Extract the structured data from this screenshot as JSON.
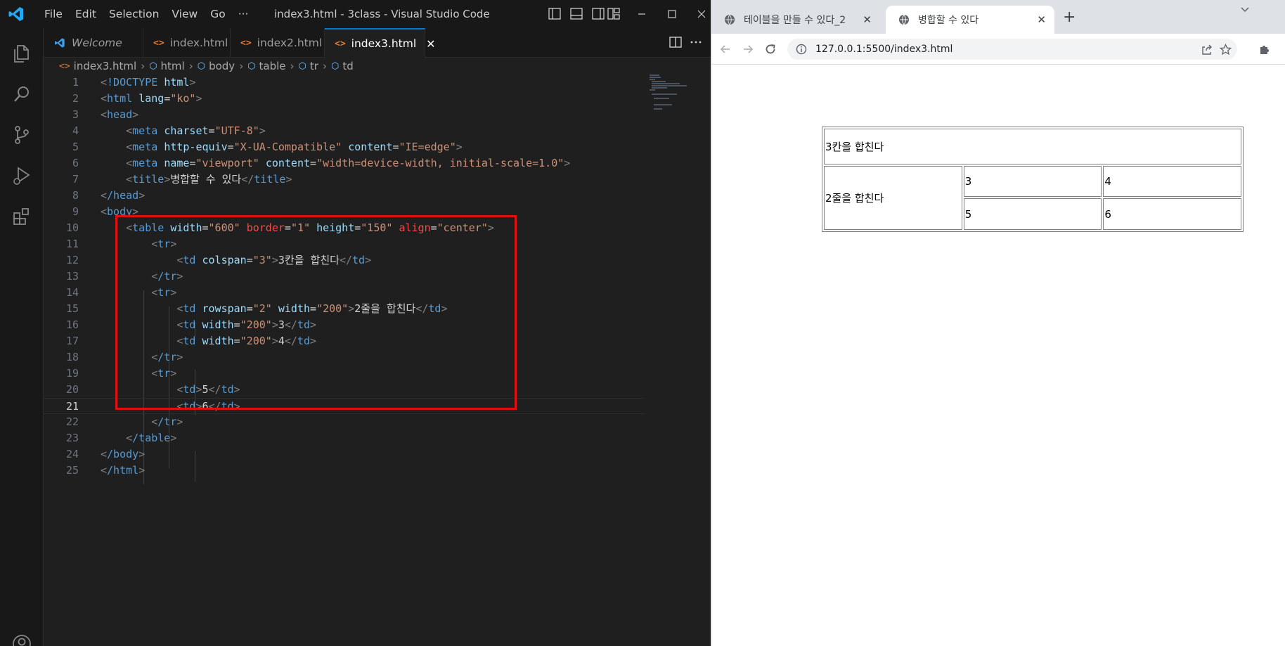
{
  "vscode": {
    "title": "index3.html - 3class - Visual Studio Code",
    "menu": [
      "File",
      "Edit",
      "Selection",
      "View",
      "Go",
      "···"
    ],
    "tabs": [
      {
        "label": "Welcome"
      },
      {
        "label": "index.html"
      },
      {
        "label": "index2.html"
      },
      {
        "label": "index3.html",
        "close": "✕"
      }
    ],
    "breadcrumb": [
      "index3.html",
      "html",
      "body",
      "table",
      "tr",
      "td"
    ],
    "line_numbers": [
      "1",
      "2",
      "3",
      "4",
      "5",
      "6",
      "7",
      "8",
      "9",
      "10",
      "11",
      "12",
      "13",
      "14",
      "15",
      "16",
      "17",
      "18",
      "19",
      "20",
      "21",
      "22",
      "23",
      "24",
      "25"
    ],
    "current_line": "21",
    "colors": {
      "accent": "#0078d4",
      "highlight_box": "#e01010",
      "tag": "#569cd6",
      "attr": "#9cdcfe",
      "value": "#ce9178"
    }
  },
  "code": {
    "l1": {
      "doctype": "!DOCTYPE",
      "html": "html"
    },
    "l2": {
      "tag": "html",
      "attr": "lang",
      "val": "\"ko\""
    },
    "l3": {
      "tag": "head"
    },
    "l4": {
      "tag": "meta",
      "attr": "charset",
      "val": "\"UTF-8\""
    },
    "l5": {
      "tag": "meta",
      "attr1": "http-equiv",
      "val1": "\"X-UA-Compatible\"",
      "attr2": "content",
      "val2": "\"IE=edge\""
    },
    "l6": {
      "tag": "meta",
      "attr1": "name",
      "val1": "\"viewport\"",
      "attr2": "content",
      "val2": "\"width=device-width, initial-scale=1.0\""
    },
    "l7": {
      "tag": "title",
      "text": "병합할 수 있다"
    },
    "l8": {
      "tag": "/head"
    },
    "l9": {
      "tag": "body"
    },
    "l10": {
      "tag": "table",
      "a1": "width",
      "v1": "\"600\"",
      "a2": "border",
      "v2": "\"1\"",
      "a3": "height",
      "v3": "\"150\"",
      "a4": "align",
      "v4": "\"center\""
    },
    "l11": {
      "tag": "tr"
    },
    "l12": {
      "tag": "td",
      "attr": "colspan",
      "val": "\"3\"",
      "text": "3칸을 합친다"
    },
    "l13": {
      "tag": "/tr"
    },
    "l14": {
      "tag": "tr"
    },
    "l15": {
      "tag": "td",
      "a1": "rowspan",
      "v1": "\"2\"",
      "a2": "width",
      "v2": "\"200\"",
      "text": "2줄을 합친다"
    },
    "l16": {
      "tag": "td",
      "attr": "width",
      "val": "\"200\"",
      "text": "3"
    },
    "l17": {
      "tag": "td",
      "attr": "width",
      "val": "\"200\"",
      "text": "4"
    },
    "l18": {
      "tag": "/tr"
    },
    "l19": {
      "tag": "tr"
    },
    "l20": {
      "tag": "td",
      "text": "5"
    },
    "l21": {
      "tag": "td",
      "text": "6"
    },
    "l22": {
      "tag": "/tr"
    },
    "l23": {
      "tag": "/table"
    },
    "l24": {
      "tag": "/body"
    },
    "l25": {
      "tag": "/html"
    }
  },
  "browser": {
    "tabs": [
      {
        "title": "테이블을 만들 수 있다_2",
        "close": "✕"
      },
      {
        "title": "병합할 수 있다",
        "close": "✕"
      }
    ],
    "new_tab": "+",
    "url": "127.0.0.1:5500/index3.html"
  },
  "table": {
    "row1": "3칸을 합친다",
    "rowspan_cell": "2줄을 합친다",
    "c3": "3",
    "c4": "4",
    "c5": "5",
    "c6": "6"
  }
}
